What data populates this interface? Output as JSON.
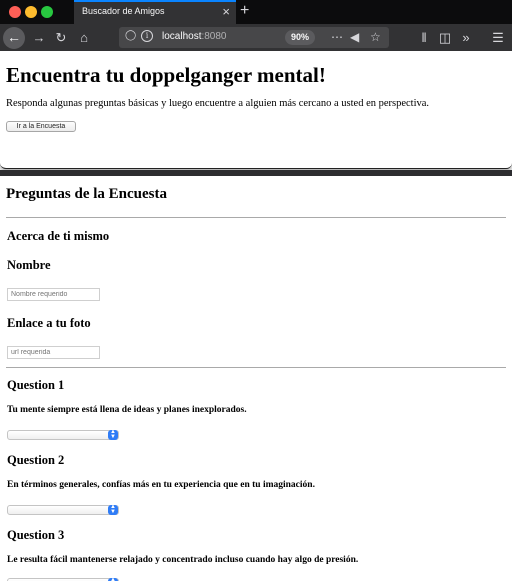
{
  "browser": {
    "tab_title": "Buscador de Amigos",
    "tab_close_icon": "×",
    "new_tab_icon": "+",
    "url_host": "localhost",
    "url_port": ":8080",
    "zoom": "90%",
    "icons": [
      "back-arrow-icon",
      "forward-arrow-icon",
      "reload-icon",
      "home-icon",
      "shield-icon",
      "info-icon",
      "page-actions-icon",
      "pocket-icon",
      "bookmark-star-icon",
      "library-icon",
      "reader-view-icon",
      "overflow-chevron-icon",
      "hamburger-menu-icon"
    ]
  },
  "hero": {
    "title": "Encuentra tu doppelganger mental!",
    "lead": "Responda algunas preguntas básicas y luego encuentre a alguien más cercano a usted en perspectiva.",
    "button_label": "Ir a la Encuesta"
  },
  "survey": {
    "heading": "Preguntas de la Encuesta",
    "about_heading": "Acerca de ti mismo",
    "name_label": "Nombre",
    "name_placeholder": "Nombre requerido",
    "photo_label": "Enlace a tu foto",
    "photo_placeholder": "url requerida",
    "questions": [
      {
        "label": "Question 1",
        "text": "Tu mente siempre está llena de ideas y planes inexplorados.",
        "selected": ""
      },
      {
        "label": "Question 2",
        "text": "En términos generales, confías más en tu experiencia que en tu imaginación.",
        "selected": ""
      },
      {
        "label": "Question 3",
        "text": "Le resulta fácil mantenerse relajado y concentrado incluso cuando hay algo de presión.",
        "selected": ""
      }
    ]
  },
  "colors": {
    "accent": "#0a84ff",
    "toolbar": "#323234",
    "select_arrow": "#2f7cf6"
  }
}
